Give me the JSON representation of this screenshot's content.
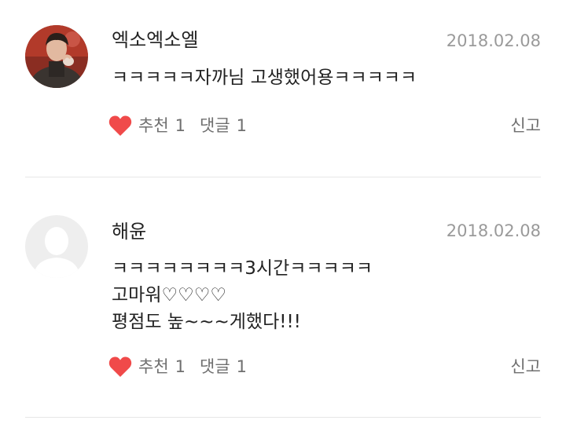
{
  "comments": [
    {
      "author": "엑소엑소엘",
      "date": "2018.02.08",
      "lines": [
        "ㅋㅋㅋㅋㅋ자까님 고생했어용ㅋㅋㅋㅋㅋ"
      ],
      "like_label": "추천",
      "like_count": "1",
      "reply_label": "댓글",
      "reply_count": "1",
      "report_label": "신고",
      "avatar": "user-photo"
    },
    {
      "author": "해윤",
      "date": "2018.02.08",
      "lines": [
        "ㅋㅋㅋㅋㅋㅋㅋㅋ3시간ㅋㅋㅋㅋㅋ",
        "고마워♡♡♡♡",
        "평점도 높~~~게했다!!!"
      ],
      "like_label": "추천",
      "like_count": "1",
      "reply_label": "댓글",
      "reply_count": "1",
      "report_label": "신고",
      "avatar": "default-user-placeholder"
    }
  ],
  "colors": {
    "heart": "#f04a4a",
    "date": "#9a9a9a",
    "meta": "#6f6f6f",
    "divider": "#e6e6e6"
  }
}
